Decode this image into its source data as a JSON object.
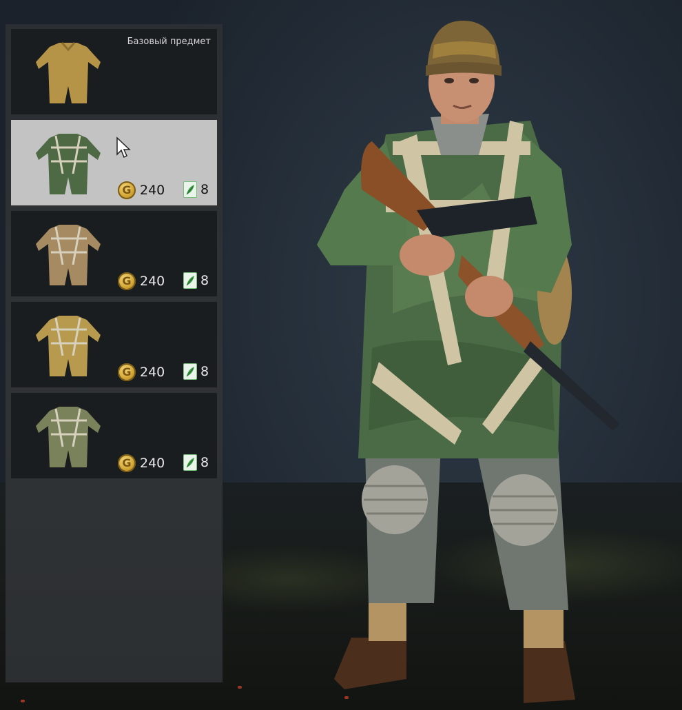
{
  "panel": {
    "base_label": "Базовый предмет",
    "items": [
      {
        "name": "uniform-tan-base",
        "selected": false,
        "base": true,
        "color": "#b59447"
      },
      {
        "name": "uniform-green-harness",
        "selected": true,
        "coins": "240",
        "tickets": "8",
        "color": "#4d6a44"
      },
      {
        "name": "uniform-tan-camo",
        "selected": false,
        "coins": "240",
        "tickets": "8",
        "color": "#a68a62"
      },
      {
        "name": "uniform-yellow-harness",
        "selected": false,
        "coins": "240",
        "tickets": "8",
        "color": "#b79a4d"
      },
      {
        "name": "uniform-olive-harness",
        "selected": false,
        "coins": "240",
        "tickets": "8",
        "color": "#79825a"
      }
    ]
  },
  "icons": {
    "currency": "gold-coin-icon",
    "ticket": "green-ticket-icon",
    "cursor": "mouse-cursor-icon"
  }
}
